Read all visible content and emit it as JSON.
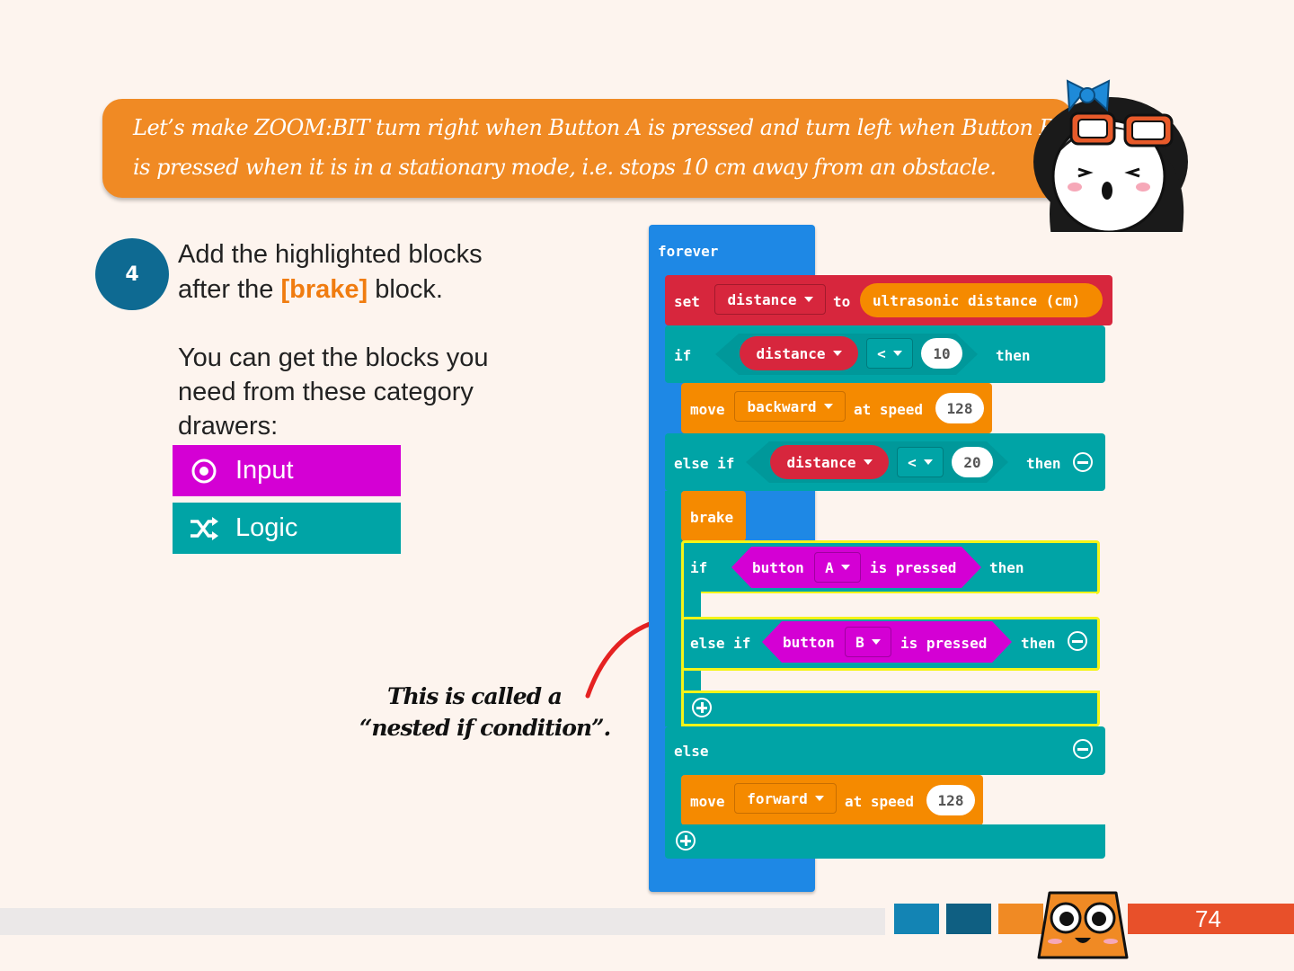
{
  "banner": {
    "line1": "Let’s make ZOOM:BIT turn right when Button A is pressed and turn left when Button B",
    "line2": "is pressed when it is in a stationary mode, i.e. stops 10 cm away from an obstacle."
  },
  "step": {
    "number": "4",
    "line1": "Add the highlighted blocks",
    "line2_pre": "after the ",
    "line2_brake": "[brake]",
    "line2_post": " block.",
    "para_line1": "You can get the blocks you",
    "para_line2": "need from these category",
    "para_line3": "drawers:"
  },
  "categories": [
    {
      "label": "Input",
      "color": "#d400d4",
      "icon": "target-icon"
    },
    {
      "label": "Logic",
      "color": "#00a4a6",
      "icon": "shuffle-icon"
    }
  ],
  "callout": {
    "line1": "This is called a",
    "line2": "“nested if condition”."
  },
  "blocks": {
    "forever": "forever",
    "set": "set",
    "distance_var": "distance",
    "to": "to",
    "ultrasonic": "ultrasonic distance (cm)",
    "if": "if",
    "lt": "<",
    "val10": "10",
    "then": "then",
    "move": "move",
    "backward": "backward",
    "at_speed": "at speed",
    "speed128": "128",
    "else_if": "else if",
    "val20": "20",
    "brake": "brake",
    "button": "button",
    "btnA": "A",
    "btnB": "B",
    "is_pressed": "is pressed",
    "else": "else",
    "forward": "forward"
  },
  "page_number": "74",
  "colors": {
    "teal": "#00a4a6",
    "orange": "#f58a00",
    "red": "#d7263d",
    "magenta": "#d400d4",
    "blue": "#1e88e5",
    "highlight": "#f4f418"
  }
}
